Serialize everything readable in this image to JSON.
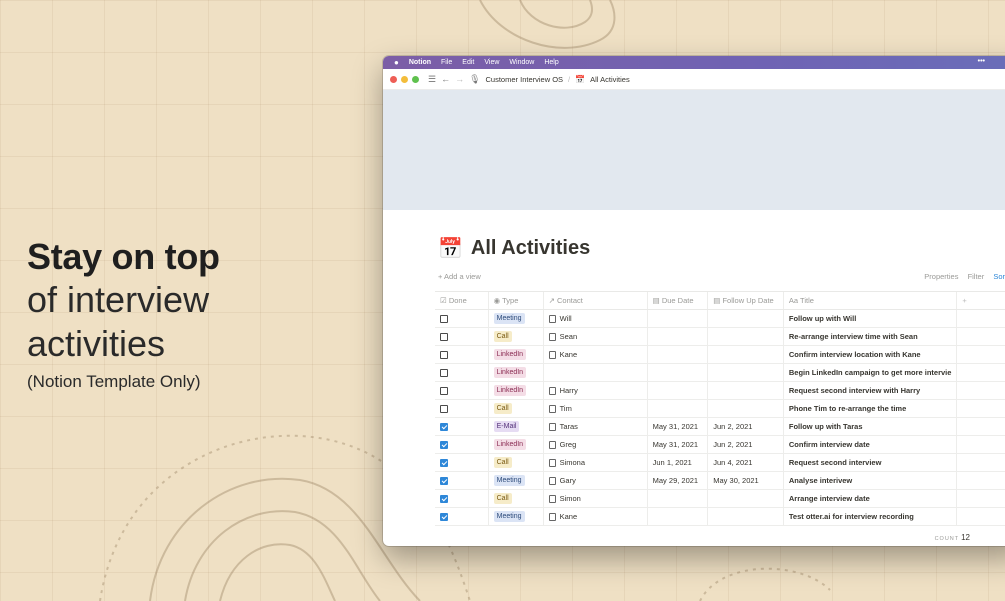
{
  "hero": {
    "line1": "Stay on top",
    "line2": "of interview",
    "line3": "activities",
    "line4": "(Notion Template Only)"
  },
  "menubar": {
    "apple": "",
    "app": "Notion",
    "items": [
      "File",
      "Edit",
      "View",
      "Window",
      "Help"
    ],
    "more": "•••"
  },
  "toolbar": {
    "breadcrumb_1": "Customer Interview OS",
    "breadcrumb_2": "All Activities"
  },
  "page": {
    "title": "All Activities",
    "add_view": "+ Add a view",
    "properties": "Properties",
    "filter": "Filter",
    "sort": "Sor"
  },
  "table": {
    "headers": {
      "done": "Done",
      "type": "Type",
      "contact": "Contact",
      "due": "Due Date",
      "followup": "Follow Up Date",
      "title": "Title",
      "plus": "+"
    },
    "rows": [
      {
        "done": false,
        "type": "Meeting",
        "contact": "Will",
        "due": "",
        "followup": "",
        "title": "Follow up with Will"
      },
      {
        "done": false,
        "type": "Call",
        "contact": "Sean",
        "due": "",
        "followup": "",
        "title": "Re-arrange interview time with Sean"
      },
      {
        "done": false,
        "type": "LinkedIn",
        "contact": "Kane",
        "due": "",
        "followup": "",
        "title": "Confirm interview location with Kane"
      },
      {
        "done": false,
        "type": "LinkedIn",
        "contact": "",
        "due": "",
        "followup": "",
        "title": "Begin LinkedIn campaign to get more intervie"
      },
      {
        "done": false,
        "type": "LinkedIn",
        "contact": "Harry",
        "due": "",
        "followup": "",
        "title": "Request second interview with Harry"
      },
      {
        "done": false,
        "type": "Call",
        "contact": "Tim",
        "due": "",
        "followup": "",
        "title": "Phone Tim to re-arrange the time"
      },
      {
        "done": true,
        "type": "E-Mail",
        "contact": "Taras",
        "due": "May 31, 2021",
        "followup": "Jun 2, 2021",
        "title": "Follow up with Taras"
      },
      {
        "done": true,
        "type": "LinkedIn",
        "contact": "Greg",
        "due": "May 31, 2021",
        "followup": "Jun 2, 2021",
        "title": "Confirm interview date"
      },
      {
        "done": true,
        "type": "Call",
        "contact": "Simona",
        "due": "Jun 1, 2021",
        "followup": "Jun 4, 2021",
        "title": "Request second interview"
      },
      {
        "done": true,
        "type": "Meeting",
        "contact": "Gary",
        "due": "May 29, 2021",
        "followup": "May 30, 2021",
        "title": "Analyse interivew"
      },
      {
        "done": true,
        "type": "Call",
        "contact": "Simon",
        "due": "",
        "followup": "",
        "title": "Arrange interview date"
      },
      {
        "done": true,
        "type": "Meeting",
        "contact": "Kane",
        "due": "",
        "followup": "",
        "title": "Test otter.ai for interview recording"
      }
    ],
    "count_label": "COUNT",
    "count_value": "12"
  },
  "colors": {
    "background": "#efe0c4",
    "tag_meeting_bg": "#dbe4f5",
    "tag_meeting_fg": "#2c4a7a",
    "tag_call_bg": "#f6ecc9",
    "tag_call_fg": "#7a5a12",
    "tag_linkedin_bg": "#f4dde6",
    "tag_linkedin_fg": "#8a2b52",
    "tag_email_bg": "#e6dcf3",
    "tag_email_fg": "#55327a",
    "checkbox_checked": "#2e87d8"
  }
}
